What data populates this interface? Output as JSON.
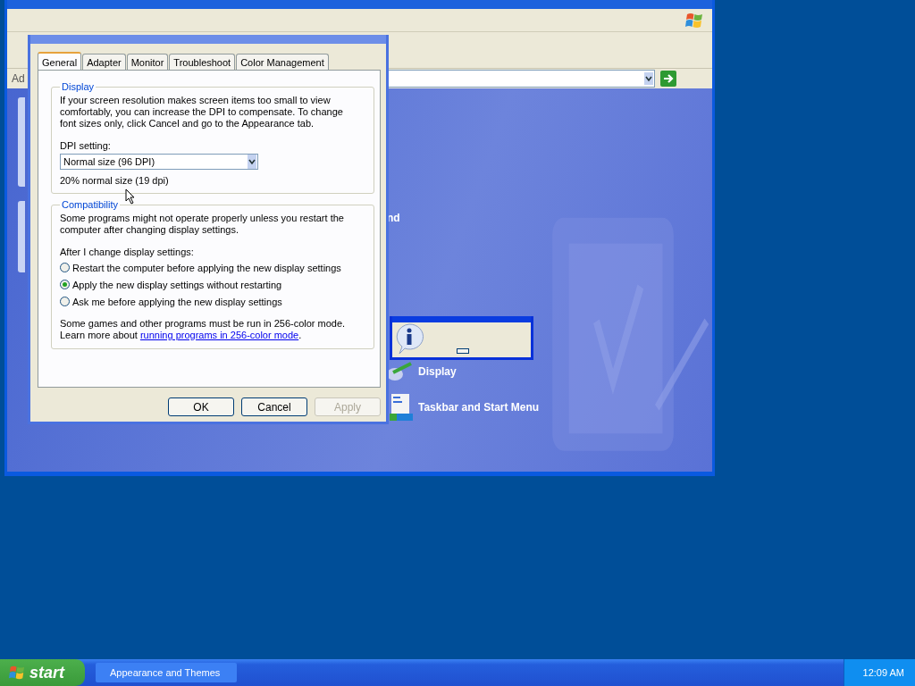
{
  "explorer": {
    "address_label": "Ad",
    "category_items": [
      {
        "label": "nd",
        "kind": "cut"
      },
      {
        "label": "Display",
        "kind": "display"
      },
      {
        "label": "Taskbar and Start Menu",
        "kind": "taskbar"
      }
    ]
  },
  "dialog": {
    "tabs": [
      {
        "label": "General",
        "selected": true
      },
      {
        "label": "Adapter",
        "selected": false
      },
      {
        "label": "Monitor",
        "selected": false
      },
      {
        "label": "Troubleshoot",
        "selected": false
      },
      {
        "label": "Color Management",
        "selected": false
      }
    ],
    "display_group": {
      "title": "Display",
      "description": "If your screen resolution makes screen items too small to view comfortably, you can increase the DPI to compensate.  To change font sizes only, click Cancel and go to the Appearance tab.",
      "dpi_label": "DPI setting:",
      "dpi_value": "Normal size (96 DPI)",
      "dpi_note": "20% normal size (19 dpi)"
    },
    "compat_group": {
      "title": "Compatibility",
      "description": "Some programs might not operate properly unless you restart the computer after changing display settings.",
      "prompt": "After I change display settings:",
      "options": [
        {
          "label": "Restart the computer before applying the new display settings",
          "selected": false
        },
        {
          "label": "Apply the new display settings without restarting",
          "selected": true
        },
        {
          "label": "Ask me before applying the new display settings",
          "selected": false
        }
      ],
      "note_first": "Some games and other programs must be run in 256-color mode.",
      "note_second": "Learn more about ",
      "link": "running programs in 256-color mode",
      "note_end": "."
    },
    "buttons": [
      {
        "label": "OK",
        "disabled": false
      },
      {
        "label": "Cancel",
        "disabled": false
      },
      {
        "label": "Apply",
        "disabled": true
      }
    ]
  },
  "taskbar": {
    "start": "start",
    "tasks": [
      {
        "label": "Appearance and Themes"
      }
    ],
    "clock": "12:09 AM"
  }
}
